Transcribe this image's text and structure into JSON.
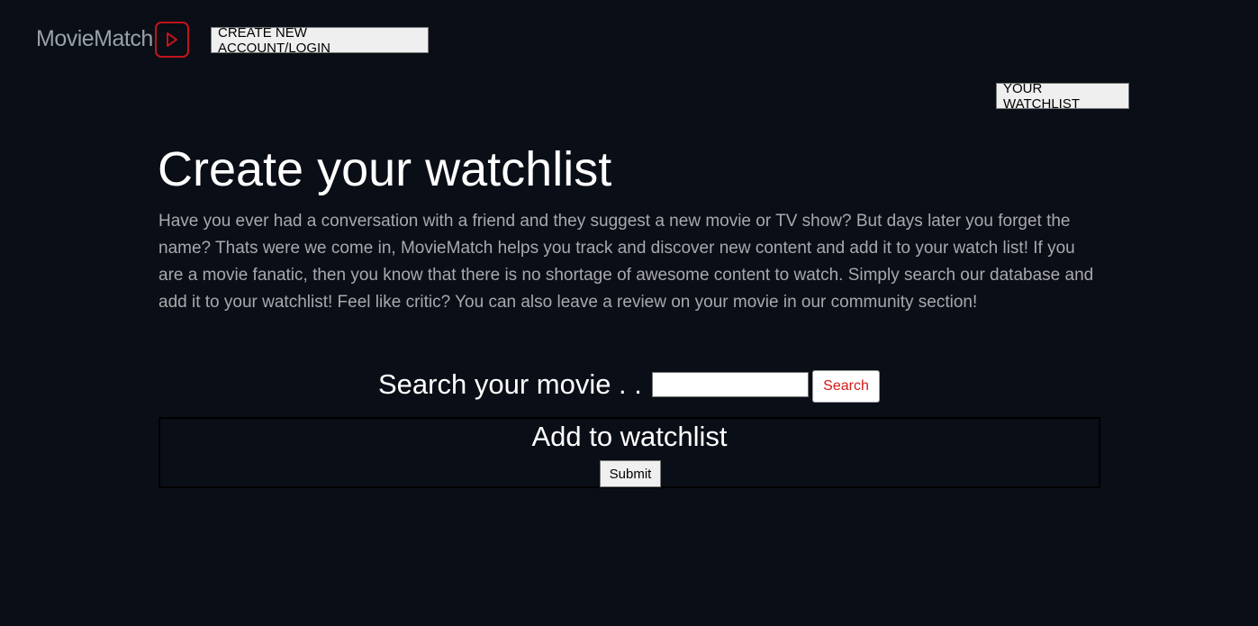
{
  "header": {
    "logo_text": "MovieMatch",
    "logo_icon": "play-icon",
    "brand_color": "#c0141b",
    "create_account_label": "CREATE NEW ACCOUNT/LOGIN",
    "watchlist_label": "YOUR WATCHLIST"
  },
  "main": {
    "title": "Create your watchlist",
    "intro": "Have you ever had a conversation with a friend and they suggest a new movie or TV show? But days later you forget the name? Thats were we come in, MovieMatch helps you track and discover new content and add it to your watch list! If you are a movie fanatic, then you know that there is no shortage of awesome content to watch. Simply search our database and add it to your watchlist! Feel like critic? You can also leave a review on your movie in our community section!"
  },
  "search": {
    "label": "Search your movie . .",
    "value": "",
    "button_label": "Search",
    "button_color": "#d11a1a"
  },
  "add_panel": {
    "title": "Add to watchlist",
    "submit_label": "Submit"
  },
  "colors": {
    "background": "#0a0e16"
  }
}
